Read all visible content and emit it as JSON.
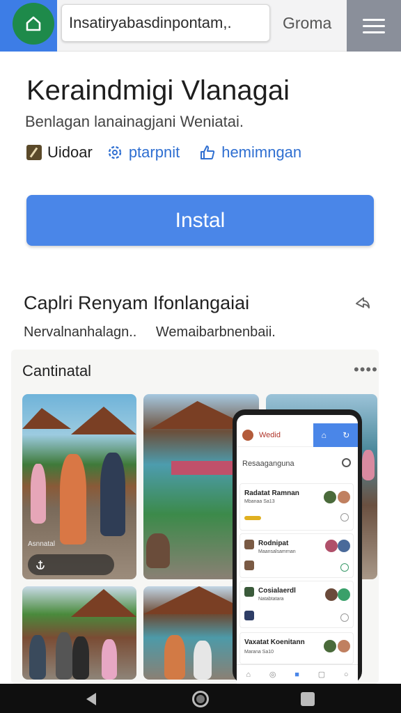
{
  "browser": {
    "url": "Insatiryabasdinpontam,.",
    "tab_label": "Groma"
  },
  "app": {
    "title": "Keraindmigi Vlanagai",
    "subtitle": "Benlagan lanainagjani Weniatai.",
    "meta": [
      {
        "icon": "edit-icon",
        "label": "Uidoar"
      },
      {
        "icon": "gear-icon",
        "label": "ptarpnit"
      },
      {
        "icon": "thumbs-up-icon",
        "label": "hemimngan"
      }
    ],
    "install_label": "Instal"
  },
  "section": {
    "title": "Caplri Renyam Ifonlangaiai",
    "subtitle_left": "Nervalnanhalagn..",
    "subtitle_right": "Wemaibarbnenbaii.",
    "gallery_title": "Cantinatal",
    "more": "••••"
  },
  "photo_caption": "Asnnatal",
  "phone_screen": {
    "header_title": "Wedid",
    "search_text": "Resaaganguna",
    "cards": [
      {
        "title": "Radatat Ramnan",
        "sub": "Mbanaa Sa13"
      },
      {
        "title": "Rodnipat",
        "sub": "Maansalsamrnan"
      },
      {
        "title": "Cosialaerdl",
        "sub": "Natabtatara"
      },
      {
        "title": "Vaxatat Koenitann",
        "sub": "Marana Sa10"
      }
    ]
  },
  "colors": {
    "accent": "#4a86e8",
    "home_button": "#1e8a4a",
    "browser_left_tab": "#3d7de6"
  }
}
